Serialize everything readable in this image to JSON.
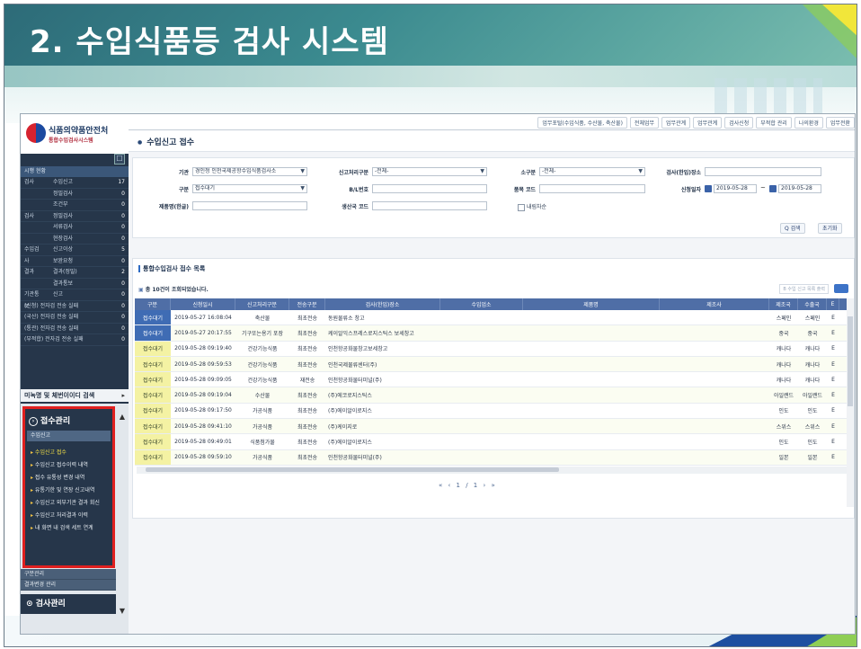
{
  "slide": {
    "title": "2. 수입식품등 검사 시스템"
  },
  "sidebar": {
    "logo_line1": "식품의약품안전처",
    "logo_line2": "통합수입검사시스템",
    "toggle_icon": "☐",
    "summary_header": "시행 현황",
    "summary": [
      {
        "group": "검사",
        "label": "수입신고",
        "count": "17"
      },
      {
        "group": "",
        "label": "정밀검사",
        "count": "0"
      },
      {
        "group": "",
        "label": "조건부",
        "count": "0"
      },
      {
        "group": "검사",
        "label": "정밀검사",
        "count": "0"
      },
      {
        "group": "",
        "label": "서류검사",
        "count": "0"
      },
      {
        "group": "",
        "label": "현장검사",
        "count": "0"
      },
      {
        "group": "수입검사",
        "label": "신고이상",
        "count": "5"
      },
      {
        "group": "",
        "label": "보완요청",
        "count": "0"
      },
      {
        "group": "결과",
        "label": "결과(정밀)",
        "count": "2"
      },
      {
        "group": "",
        "label": "결과통보",
        "count": "0"
      },
      {
        "group": "기관통보",
        "label": "신고",
        "count": "0"
      },
      {
        "group": "",
        "label": "(신청) 전자검 전송 실패",
        "count": "0",
        "wide": true
      },
      {
        "group": "",
        "label": "(국산) 전자검 전송 실패",
        "count": "0",
        "wide": true
      },
      {
        "group": "",
        "label": "(통관) 전자검 전송 실패",
        "count": "0",
        "wide": true
      },
      {
        "group": "",
        "label": "(부적합) 전자검 전송 실패",
        "count": "0",
        "wide": true
      }
    ],
    "search_label": "미녹명 및 체번이이디 검색",
    "menu_title": "접수관리",
    "menu_sub": "수입신고",
    "menu_items": [
      {
        "label": "수입신고 접수",
        "active": true
      },
      {
        "label": "수입신고 접수이력 내역",
        "active": false
      },
      {
        "label": "접수 유통성 변경 내역",
        "active": false
      },
      {
        "label": "유통기한 및 연장 신고내역",
        "active": false
      },
      {
        "label": "수입신고 외부기관 결과 회신",
        "active": false
      },
      {
        "label": "수입신고 처리결과 이력",
        "active": false
      },
      {
        "label": "내 화면 내 검색 세트 연계",
        "active": false
      }
    ],
    "menu_extra": [
      "구분관리",
      "결과변경 관리"
    ],
    "menu_section2": "검사관리"
  },
  "topbar": {
    "links": [
      "업무포털(수입식품, 수산물, 축산물)",
      "전체업무",
      "업무관계",
      "업무관계",
      "검사신청",
      "부적합 관리",
      "나의환경",
      "업무전환"
    ]
  },
  "page": {
    "title": "수입신고 접수"
  },
  "filters": {
    "institution_label": "기관",
    "institution_value": "경인청 인천국제공항수입식품검사소",
    "report_type_label": "신고처리구분",
    "report_type_value": "-전체-",
    "category_label": "소구분",
    "category_value": "-전체-",
    "inspection_place_label": "검사(한입)장소",
    "inspection_place_value": "",
    "category2_label": "구분",
    "category2_value": "접수대기",
    "bl_label": "B/L번호",
    "bl_value": "",
    "item_code_label": "품목 코드",
    "item_code_value": "",
    "date_label": "신청일자",
    "date_from": "2019-05-28",
    "date_sep": "~",
    "date_to": "2019-05-28",
    "product_label": "제품명(한글)",
    "product_value": "",
    "country_label": "생산국 코드",
    "country_value": "",
    "check_label": "내림차순",
    "search_button": "Q 검색",
    "reset_button": "초기화"
  },
  "list": {
    "title": "통합수입검사 접수 목록",
    "count_text": "총 10건이 조회되었습니다.",
    "action_label": "B 수입 신고 목록 출력",
    "columns": [
      "구분",
      "신청일시",
      "신고처리구분",
      "전송구분",
      "검사(한입)장소",
      "수입업소",
      "제품명",
      "제조사",
      "제조국",
      "수출국",
      "E"
    ],
    "rows": [
      {
        "status": "접수대기",
        "status_type": "blue",
        "datetime": "2019-05-27 16:08:04",
        "proc": "축산물",
        "trans": "최초전송",
        "place": "동원물류소 창고",
        "importer": "",
        "product": "",
        "maker": "",
        "country": "스페인",
        "exporter": "스페인",
        "e": "E"
      },
      {
        "status": "접수대기",
        "status_type": "blue",
        "datetime": "2019-05-27 20:17:55",
        "proc": "기구또는용기 포장",
        "trans": "최초전송",
        "place": "케이알익스프레스로지스틱스 보세창고",
        "importer": "",
        "product": "",
        "maker": "",
        "country": "중국",
        "exporter": "중국",
        "e": "E"
      },
      {
        "status": "접수대기",
        "status_type": "yellow",
        "datetime": "2019-05-28 09:19:40",
        "proc": "건강기능식품",
        "trans": "최초전송",
        "place": "인천항공화물창고보세창고",
        "importer": "",
        "product": "",
        "maker": "",
        "country": "캐나다",
        "exporter": "캐나다",
        "e": "E"
      },
      {
        "status": "접수대기",
        "status_type": "yellow",
        "datetime": "2019-05-28 09:59:53",
        "proc": "건강기능식품",
        "trans": "최초전송",
        "place": "인천국제물류센터(주)",
        "importer": "",
        "product": "",
        "maker": "",
        "country": "캐나다",
        "exporter": "캐나다",
        "e": "E"
      },
      {
        "status": "접수대기",
        "status_type": "yellow",
        "datetime": "2019-05-28 09:09:05",
        "proc": "건강기능식품",
        "trans": "재전송",
        "place": "인천항공화물터미널(주)",
        "importer": "",
        "product": "",
        "maker": "",
        "country": "캐나다",
        "exporter": "캐나다",
        "e": "E"
      },
      {
        "status": "접수대기",
        "status_type": "yellow",
        "datetime": "2019-05-28 09:19:04",
        "proc": "수산물",
        "trans": "최초전송",
        "place": "(주)에코로지스틱스",
        "importer": "",
        "product": "",
        "maker": "",
        "country": "아일랜드",
        "exporter": "아일랜드",
        "e": "E"
      },
      {
        "status": "접수대기",
        "status_type": "yellow",
        "datetime": "2019-05-28 09:17:50",
        "proc": "가공식품",
        "trans": "최초전송",
        "place": "(주)에이알이로지스",
        "importer": "",
        "product": "",
        "maker": "",
        "country": "인도",
        "exporter": "인도",
        "e": "E"
      },
      {
        "status": "접수대기",
        "status_type": "yellow",
        "datetime": "2019-05-28 09:41:10",
        "proc": "가공식품",
        "trans": "최초전송",
        "place": "(주)케이지로",
        "importer": "",
        "product": "",
        "maker": "",
        "country": "스위스",
        "exporter": "스위스",
        "e": "E"
      },
      {
        "status": "접수대기",
        "status_type": "yellow",
        "datetime": "2019-05-28 09:49:01",
        "proc": "식품첨가물",
        "trans": "최초전송",
        "place": "(주)에이알이로지스",
        "importer": "",
        "product": "",
        "maker": "",
        "country": "인도",
        "exporter": "인도",
        "e": "E"
      },
      {
        "status": "접수대기",
        "status_type": "yellow",
        "datetime": "2019-05-28 09:59:10",
        "proc": "가공식품",
        "trans": "최초전송",
        "place": "인천항공화물터미널(주)",
        "importer": "",
        "product": "",
        "maker": "",
        "country": "일본",
        "exporter": "일본",
        "e": "E"
      }
    ],
    "pager": "« ‹ 1 / 1 › »"
  }
}
